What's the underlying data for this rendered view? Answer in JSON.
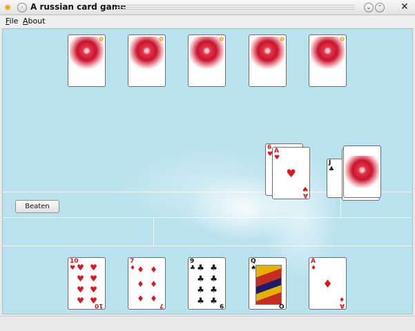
{
  "window": {
    "title": "A russian card game",
    "close_glyph": "✕",
    "minimize_glyph": "⌄",
    "maximize_glyph": "⌃",
    "menu_glyph": "◦"
  },
  "menu": {
    "items": [
      {
        "accel": "F",
        "rest": "ile"
      },
      {
        "accel": "A",
        "rest": "bout"
      }
    ]
  },
  "opponent_hand": {
    "count": 5
  },
  "table_cards": {
    "attack": {
      "rank": "6",
      "suit": "♥",
      "color": "red"
    },
    "defense": {
      "rank": "A",
      "suit": "♥",
      "color": "red"
    }
  },
  "deck": {
    "trump": {
      "rank": "J",
      "suit": "♣",
      "color": "black"
    }
  },
  "buttons": {
    "beaten": "Beaten"
  },
  "player_hand": [
    {
      "rank": "10",
      "suit": "♥",
      "color": "red"
    },
    {
      "rank": "7",
      "suit": "♦",
      "color": "red"
    },
    {
      "rank": "9",
      "suit": "♣",
      "color": "black"
    },
    {
      "rank": "Q",
      "suit": "♠",
      "color": "black"
    },
    {
      "rank": "A",
      "suit": "♦",
      "color": "red"
    }
  ],
  "colors": {
    "table_bg": "#b9e2ee",
    "red_suit": "#e0161e",
    "black_suit": "#111111"
  }
}
